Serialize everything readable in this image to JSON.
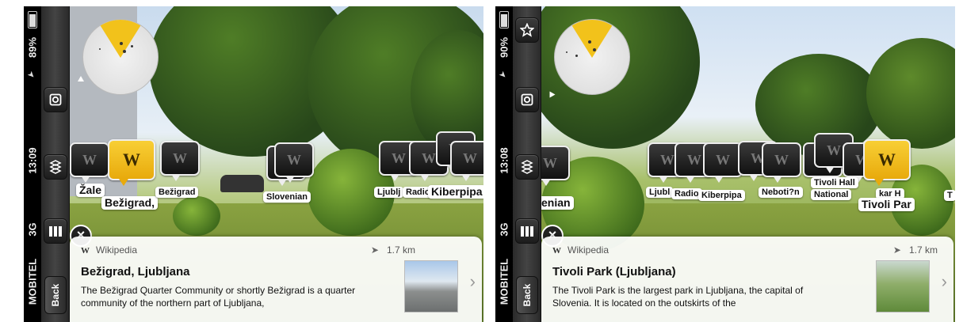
{
  "left": {
    "status": {
      "battery": "89%",
      "time": "13:09",
      "network": "3G",
      "carrier": "MOBITEL"
    },
    "toolbar": {
      "back_label": "Back"
    },
    "poi_labels": [
      "Žale",
      "Bežigrad,",
      "Bežigrad",
      "Slovenian",
      "Ljublj",
      "Radio",
      "Kiberpipa"
    ],
    "card": {
      "source": "Wikipedia",
      "distance": "1.7 km",
      "title": "Bežigrad, Ljubljana",
      "text": "The Bežigrad Quarter Community or shortly Bežigrad is a quarter community of the northern part of Ljubljana,"
    }
  },
  "right": {
    "status": {
      "battery": "90%",
      "time": "13:08",
      "network": "3G",
      "carrier": "MOBITEL"
    },
    "toolbar": {
      "back_label": "Back"
    },
    "poi_labels": [
      "enian",
      "Ljubl",
      "Radio",
      "Kiberpipa",
      "Neboti?n",
      "Tivoli Hall",
      "National",
      "kar H",
      "Tivoli Par",
      "T"
    ],
    "card": {
      "source": "Wikipedia",
      "distance": "1.7 km",
      "title": "Tivoli Park (Ljubljana)",
      "text": "The Tivoli Park is the largest park in Ljubljana, the capital of Slovenia. It is located on the outskirts of the"
    }
  },
  "icons": {
    "toolbar": [
      "camera-icon",
      "layers-icon",
      "bookmarks-icon",
      "star-icon"
    ],
    "poi": "wikipedia-icon",
    "close": "close-icon",
    "navigation": "location-arrow-icon",
    "chevron": "chevron-right-icon"
  },
  "colors": {
    "accent": "#f2c21b",
    "bubble": "#1e1e1e",
    "card": "#ffffff"
  }
}
